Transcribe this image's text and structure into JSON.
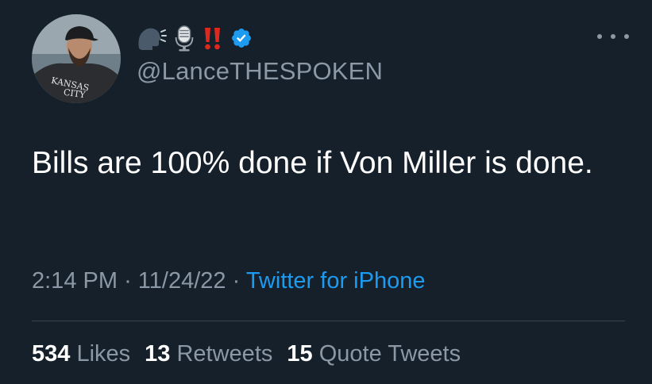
{
  "user": {
    "display_name_icons": [
      "speaking-head-icon",
      "microphone-icon",
      "double-exclamation-icon",
      "verified-badge-icon"
    ],
    "handle": "@LanceTHESPOKEN",
    "avatar_text_top": "KANSAS",
    "avatar_text_bottom": "CITY"
  },
  "tweet": {
    "text": "Bills are 100% done if Von Miller is done.",
    "time": "2:14 PM",
    "date": "11/24/22",
    "separator": "·",
    "source": "Twitter for iPhone"
  },
  "stats": {
    "likes_count": "534",
    "likes_label": "Likes",
    "retweets_count": "13",
    "retweets_label": "Retweets",
    "quotes_count": "15",
    "quotes_label": "Quote Tweets"
  },
  "colors": {
    "background": "#15202b",
    "text": "#ffffff",
    "secondary": "#8b98a5",
    "link": "#1d9bf0",
    "verified": "#1d9bf0",
    "divider": "#38444d"
  }
}
